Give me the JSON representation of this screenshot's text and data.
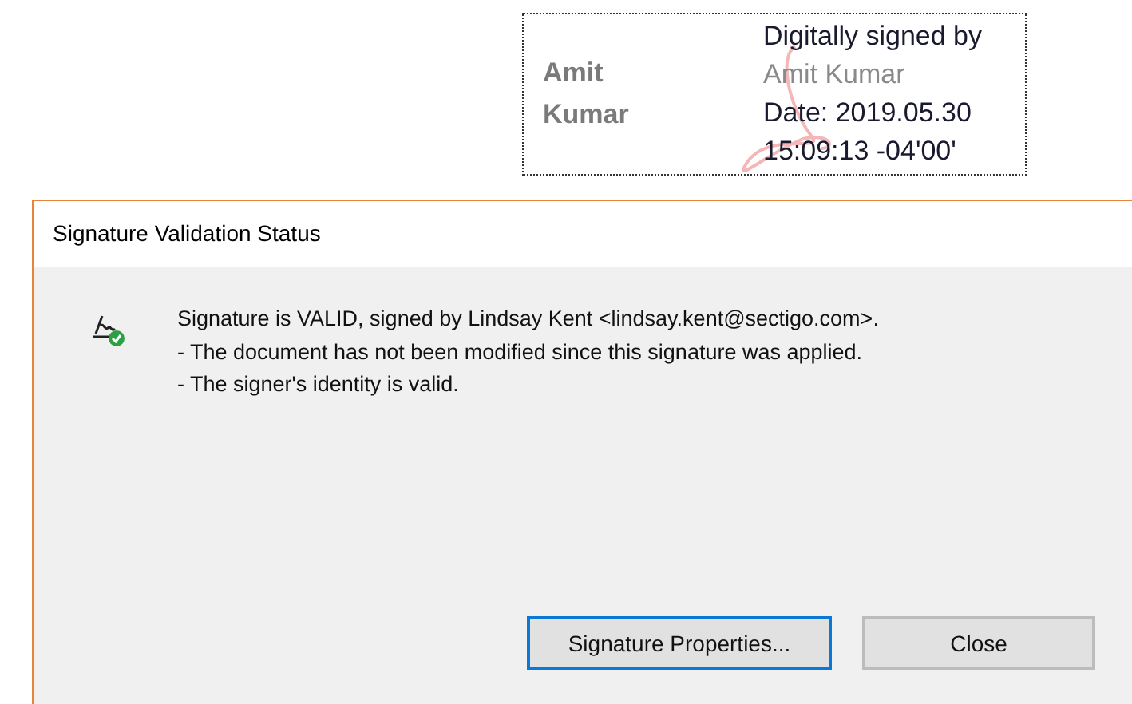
{
  "signature_stamp": {
    "name_lines": [
      "Amit",
      "Kumar"
    ],
    "details": [
      {
        "text": "Digitally signed by",
        "kind": "label"
      },
      {
        "text": "Amit Kumar",
        "kind": "name"
      },
      {
        "text": "Date: 2019.05.30",
        "kind": "label"
      },
      {
        "text": "15:09:13 -04'00'",
        "kind": "label"
      }
    ]
  },
  "dialog": {
    "title": "Signature Validation Status",
    "message_lines": [
      "Signature is VALID, signed by Lindsay Kent <lindsay.kent@sectigo.com>.",
      "- The document has not been modified since this signature was applied.",
      "- The signer's identity is valid."
    ],
    "buttons": [
      {
        "label": "Signature Properties...",
        "focused": true
      },
      {
        "label": "Close",
        "focused": false
      }
    ]
  }
}
